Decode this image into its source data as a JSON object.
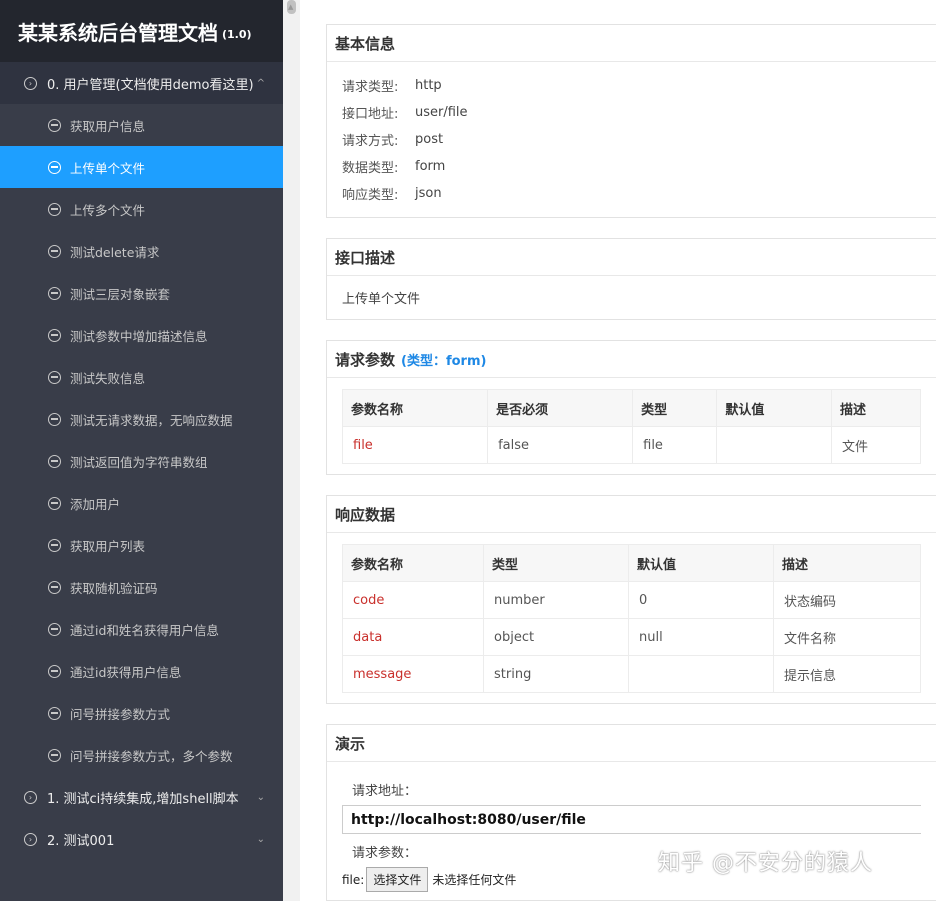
{
  "sidebar": {
    "title": "某某系统后台管理文档",
    "version": "(1.0)",
    "group0": {
      "label": "0. 用户管理(文档使用demo看这里)"
    },
    "items": [
      "获取用户信息",
      "上传单个文件",
      "上传多个文件",
      "测试delete请求",
      "测试三层对象嵌套",
      "测试参数中增加描述信息",
      "测试失败信息",
      "测试无请求数据，无响应数据",
      "测试返回值为字符串数组",
      "添加用户",
      "获取用户列表",
      "获取随机验证码",
      "通过id和姓名获得用户信息",
      "通过id获得用户信息",
      "问号拼接参数方式",
      "问号拼接参数方式，多个参数"
    ],
    "group1": {
      "label": "1. 测试ci持续集成,增加shell脚本"
    },
    "group2": {
      "label": "2. 测试001"
    }
  },
  "basic": {
    "title": "基本信息",
    "rows": [
      {
        "k": "请求类型:",
        "v": "http"
      },
      {
        "k": "接口地址:",
        "v": "user/file"
      },
      {
        "k": "请求方式:",
        "v": "post"
      },
      {
        "k": "数据类型:",
        "v": "form"
      },
      {
        "k": "响应类型:",
        "v": "json"
      }
    ]
  },
  "desc": {
    "title": "接口描述",
    "text": "上传单个文件"
  },
  "params": {
    "title": "请求参数",
    "type_note": "(类型：form)",
    "headers": [
      "参数名称",
      "是否必须",
      "类型",
      "默认值",
      "描述"
    ],
    "rows": [
      {
        "name": "file",
        "required": "false",
        "type": "file",
        "default": "",
        "desc": "文件"
      }
    ]
  },
  "response": {
    "title": "响应数据",
    "headers": [
      "参数名称",
      "类型",
      "默认值",
      "描述"
    ],
    "rows": [
      {
        "name": "code",
        "type": "number",
        "default": "0",
        "desc": "状态编码"
      },
      {
        "name": "data",
        "type": "object",
        "default": "null",
        "desc": "文件名称"
      },
      {
        "name": "message",
        "type": "string",
        "default": "",
        "desc": "提示信息"
      }
    ]
  },
  "demo": {
    "title": "演示",
    "url_label": "请求地址：",
    "url": "http://localhost:8080/user/file",
    "params_label": "请求参数：",
    "file_label": "file:",
    "file_button": "选择文件",
    "file_status": "未选择任何文件"
  },
  "watermark": "知乎 @不安分的猿人",
  "colors": {
    "accent": "#1e9fff",
    "sidebar_bg": "#393d49",
    "param_name": "#c9302c"
  }
}
